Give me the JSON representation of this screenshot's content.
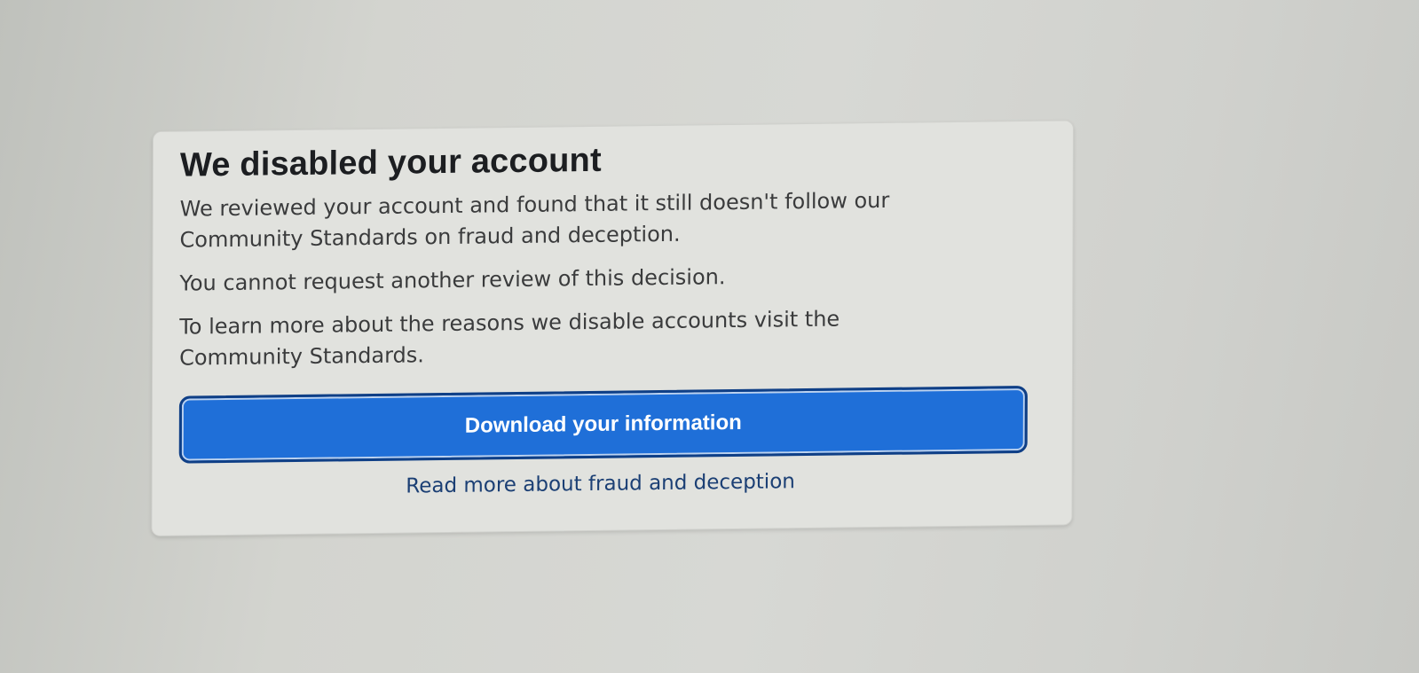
{
  "notice": {
    "title": "We disabled your account",
    "paragraph1_line1": "We reviewed your account and found that it still doesn't follow our",
    "paragraph1_line2": "Community Standards on fraud and deception.",
    "paragraph2": "You cannot request another review of this decision.",
    "paragraph3_line1": "To learn more about the reasons we disable accounts visit the",
    "paragraph3_line2": "Community Standards.",
    "primary_button_label": "Download your information",
    "secondary_link_label": "Read more about fraud and deception"
  },
  "colors": {
    "primary_button": "#1f6fd8",
    "link": "#1b3f74",
    "card_background": "#e1e2de"
  }
}
